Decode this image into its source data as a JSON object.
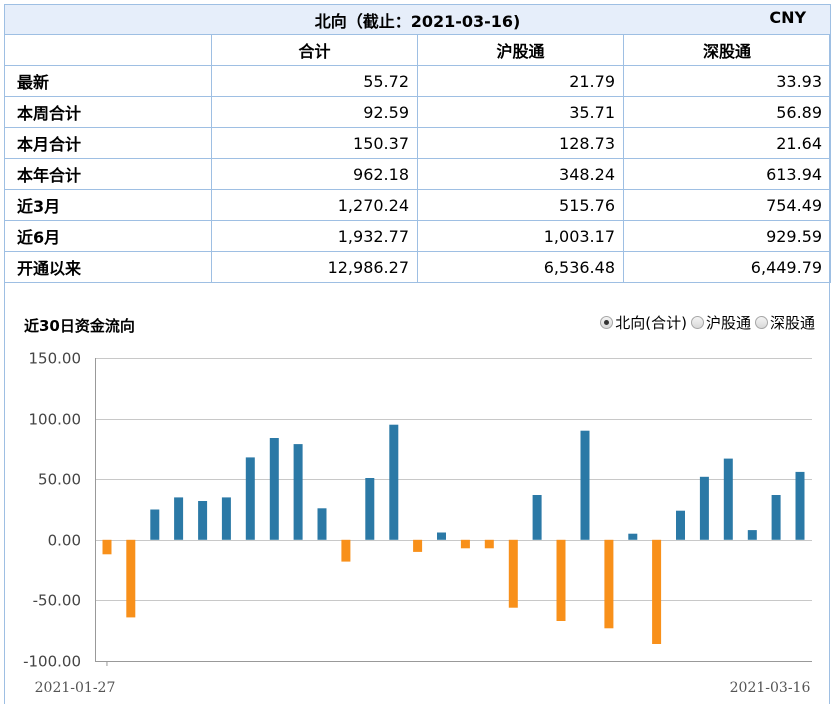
{
  "table": {
    "title": "北向（截止：2021-03-16)",
    "currency": "CNY",
    "columns": [
      "",
      "合计",
      "沪股通",
      "深股通"
    ],
    "rows": [
      {
        "label": "最新",
        "values": [
          "55.72",
          "21.79",
          "33.93"
        ]
      },
      {
        "label": "本周合计",
        "values": [
          "92.59",
          "35.71",
          "56.89"
        ]
      },
      {
        "label": "本月合计",
        "values": [
          "150.37",
          "128.73",
          "21.64"
        ]
      },
      {
        "label": "本年合计",
        "values": [
          "962.18",
          "348.24",
          "613.94"
        ]
      },
      {
        "label": "近3月",
        "values": [
          "1,270.24",
          "515.76",
          "754.49"
        ]
      },
      {
        "label": "近6月",
        "values": [
          "1,932.77",
          "1,003.17",
          "929.59"
        ]
      },
      {
        "label": "开通以来",
        "values": [
          "12,986.27",
          "6,536.48",
          "6,449.79"
        ]
      }
    ]
  },
  "chart_title": "近30日资金流向",
  "legend": [
    {
      "label": "北向(合计)",
      "selected": true
    },
    {
      "label": "沪股通",
      "selected": false
    },
    {
      "label": "深股通",
      "selected": false
    }
  ],
  "colors": {
    "positive": "#2b79a6",
    "negative": "#f8901a",
    "border": "#9ebfe3",
    "header_bg": "#e6eefa"
  },
  "chart_data": {
    "type": "bar",
    "ylim": [
      -100,
      150
    ],
    "yticks": [
      "150.00",
      "100.00",
      "50.00",
      "0.00",
      "-50.00",
      "-100.00"
    ],
    "x_first_label": "2021-01-27",
    "x_last_label": "2021-03-16",
    "values": [
      -12,
      -64,
      25,
      35,
      32,
      35,
      68,
      84,
      79,
      26,
      -18,
      51,
      95,
      -10,
      6,
      -7,
      -7,
      -56,
      37,
      -67,
      90,
      -73,
      5,
      -86,
      24,
      52,
      67,
      8,
      37,
      56
    ],
    "grid": true
  }
}
